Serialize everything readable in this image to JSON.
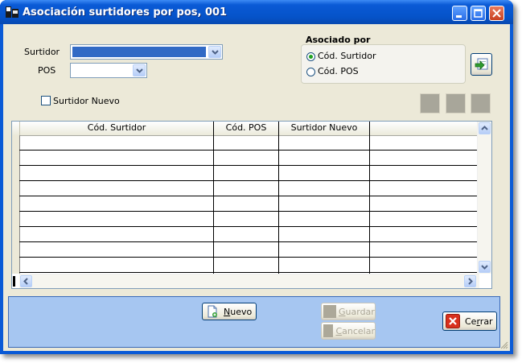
{
  "window": {
    "title": "Asociación surtidores por pos, 001"
  },
  "form": {
    "surtidor_label": "Surtidor",
    "pos_label": "POS",
    "surtidor_nuevo_label": "Surtidor Nuevo",
    "surtidor_nuevo_checked": false
  },
  "asociado": {
    "title": "Asociado por",
    "options": [
      "Cód. Surtidor",
      "Cód. POS"
    ],
    "selected": "Cód. Surtidor"
  },
  "grid": {
    "columns": [
      "Cód. Surtidor",
      "Cód. POS",
      "Surtidor Nuevo"
    ],
    "rows": []
  },
  "buttons": {
    "nuevo": {
      "label_rest": "uevo",
      "mnemonic": "N"
    },
    "guardar": {
      "label_rest": "uardar",
      "mnemonic": "G",
      "enabled": false
    },
    "cancelar": {
      "label_rest": "ancelar",
      "mnemonic": "C",
      "enabled": false
    },
    "cerrar": {
      "label_pre": "Ce",
      "mnemonic": "r",
      "label_rest": "rar"
    }
  },
  "icons": {
    "window": "app-icon",
    "associate": "refresh-link-icon",
    "nuevo": "new-document-icon",
    "cerrar": "close-x-icon"
  },
  "colors": {
    "selection": "#316ac5",
    "titlebar": "#0a5ad6",
    "bottom_panel": "#a6c6f1",
    "radio_dot": "#21a121",
    "close_icon": "#d8301c"
  }
}
